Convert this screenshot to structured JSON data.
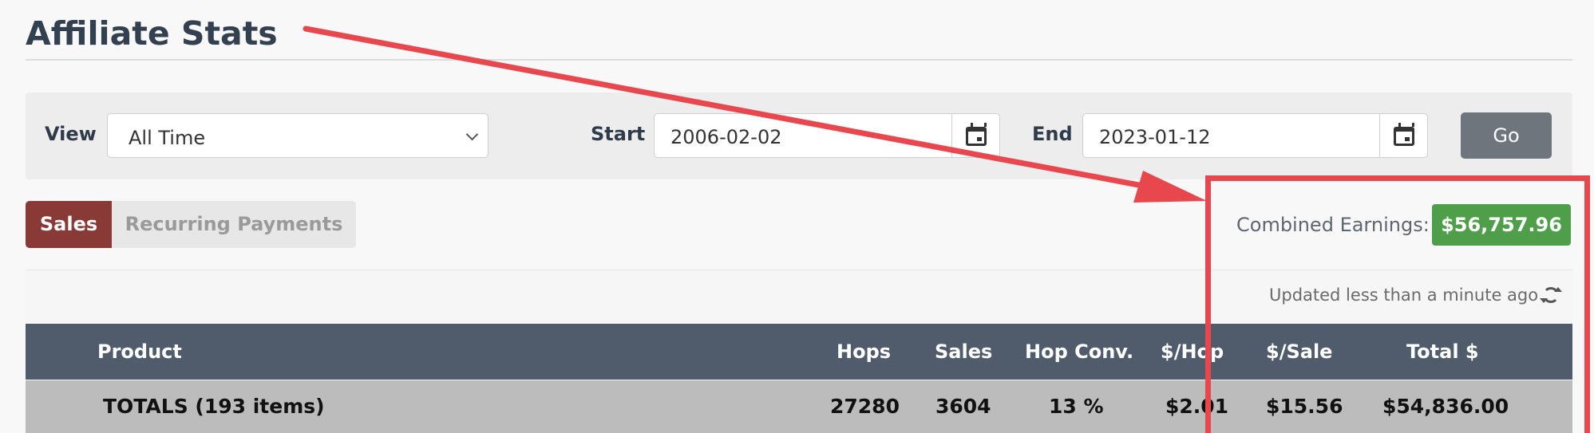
{
  "page": {
    "title": "Affiliate Stats"
  },
  "filters": {
    "view_label": "View",
    "view_value": "All Time",
    "start_label": "Start",
    "start_value": "2006-02-02",
    "end_label": "End",
    "end_value": "2023-01-12",
    "go_label": "Go"
  },
  "tabs": [
    {
      "label": "Sales",
      "active": true
    },
    {
      "label": "Recurring Payments",
      "active": false
    }
  ],
  "earnings": {
    "label": "Combined Earnings:",
    "value": "$56,757.96"
  },
  "updated_text": "Updated less than a minute ago",
  "table": {
    "headers": [
      "Product",
      "Hops",
      "Sales",
      "Hop Conv.",
      "$/Hop",
      "$/Sale",
      "Total $"
    ],
    "totals_row": [
      "TOTALS (193 items)",
      "27280",
      "3604",
      "13 %",
      "$2.01",
      "$15.56",
      "$54,836.00"
    ]
  },
  "colors": {
    "active_tab": "#8a3a36",
    "earnings_badge": "#4e9e4a",
    "header_bg": "#505b6b",
    "annotation": "#e8474d"
  },
  "icons": [
    "calendar-icon",
    "chevron-down-icon",
    "refresh-icon"
  ]
}
